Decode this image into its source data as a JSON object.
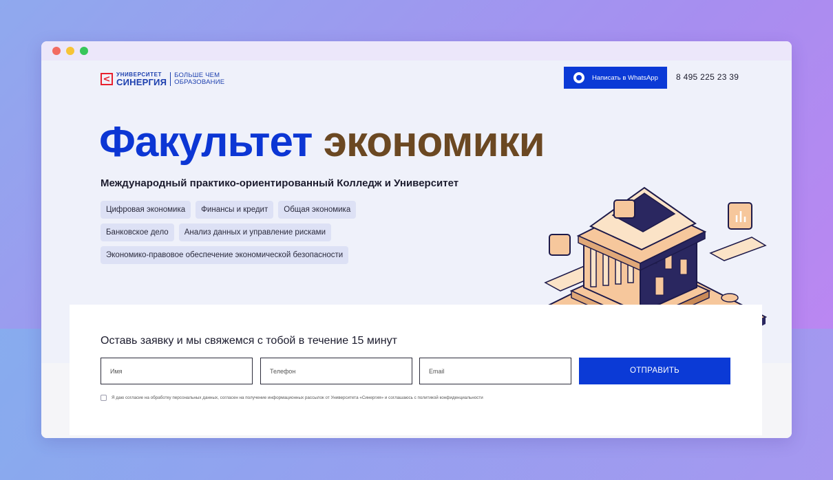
{
  "header": {
    "logo_mark": "<",
    "logo_top": "УНИВЕРСИТЕТ",
    "logo_bottom": "СИНЕРГИЯ",
    "slogan_line1": "БОЛЬШЕ ЧЕМ",
    "slogan_line2": "ОБРАЗОВАНИЕ",
    "whatsapp_label": "Написать в WhatsApp",
    "phone": "8 495 225 23 39"
  },
  "hero": {
    "title_part1": "Факультет",
    "title_part2": "экономики",
    "subtitle": "Международный практико-ориентированный Колледж и Университет",
    "tags": [
      "Цифровая экономика",
      "Финансы и кредит",
      "Общая экономика",
      "Банковское дело",
      "Анализ данных и управление рисками",
      "Экономико-правовое обеспечение экономической безопасности"
    ]
  },
  "form": {
    "title": "Оставь заявку и мы свяжемся с тобой в течение 15 минут",
    "name_placeholder": "Имя",
    "phone_placeholder": "Телефон",
    "email_placeholder": "Email",
    "submit_label": "ОТПРАВИТЬ",
    "consent": "Я даю согласие на обработку персональных данных, согласен на получение информационных рассылок от Университета «Синергия» и соглашаюсь с политикой конфиденциальности"
  },
  "colors": {
    "brand_blue": "#0b3ad6",
    "headline_blue": "#0c36d4",
    "headline_brown": "#6b4822",
    "logo_red": "#e8202d"
  },
  "icons": {
    "whatsapp": "whatsapp-icon",
    "illustration": "bank-building-illustration"
  }
}
